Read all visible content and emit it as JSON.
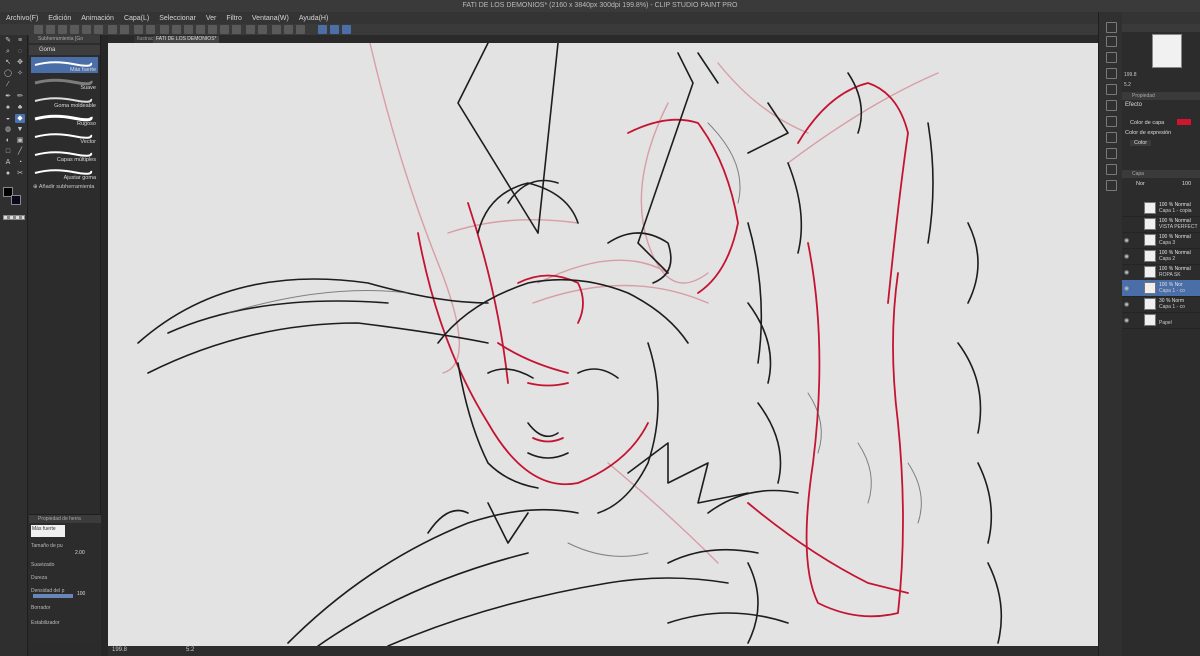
{
  "window": {
    "title": "FATI DE LOS DEMONIOS* (2160 x 3840px 300dpi 199.8%) - CLIP STUDIO PAINT PRO"
  },
  "menu": [
    "Archivo(F)",
    "Edición",
    "Animación",
    "Capa(L)",
    "Seleccionar",
    "Ver",
    "Filtro",
    "Ventana(W)",
    "Ayuda(H)"
  ],
  "tabs": [
    "Ilustración7",
    "FATI DE LOS DEMONIOS*"
  ],
  "subtool": {
    "header": "Subherramienta [Go",
    "group": "Goma",
    "brushes": [
      "Más fuerte",
      "Suave",
      "Goma moldeable",
      "Rugoso",
      "Vector",
      "Capas múltiples",
      "Ajustar goma"
    ],
    "add": "Añadir subherramienta"
  },
  "toolprop": {
    "header": "Propiedad de herra",
    "preset": "Más fuerte",
    "size_label": "Tamaño de pu",
    "size_value": "2.00",
    "smooth_label": "Suavizado",
    "hard_label": "Dureza",
    "density_label": "Densidad del p",
    "density_value": "100",
    "erase_label": "Borrador",
    "stab_label": "Estabilizador",
    "density_fill": 1.0
  },
  "status": {
    "zoom": "199.8",
    "angle": "5.2",
    "zoom_right": "199.8",
    "angle_right": "5.2"
  },
  "properties": {
    "header": "Propiedad",
    "effect": "Efecto",
    "layer_color": "Color de capa",
    "expression_color": "Color de expresión",
    "expression_value": "Color"
  },
  "layers_panel": {
    "header": "Capa",
    "blend": "Nor",
    "opacity": "100"
  },
  "layers": [
    {
      "pct": "100 % Normal",
      "name": "Capa 1 - copia",
      "selected": false,
      "visible": false
    },
    {
      "pct": "100 % Normal",
      "name": "VISTA PERFECT",
      "selected": false,
      "visible": false
    },
    {
      "pct": "100 % Normal",
      "name": "Capa 3",
      "selected": false,
      "visible": true
    },
    {
      "pct": "100 % Normal",
      "name": "Capa 2",
      "selected": false,
      "visible": true
    },
    {
      "pct": "100 % Normal",
      "name": "ROPA SK",
      "selected": false,
      "visible": true
    },
    {
      "pct": "100 % Nor",
      "name": "Capa 1 - co",
      "selected": true,
      "visible": true
    },
    {
      "pct": "30 % Norm",
      "name": "Capa 1 - co",
      "selected": false,
      "visible": true
    },
    {
      "pct": "",
      "name": "Papel",
      "selected": false,
      "visible": true
    }
  ],
  "colors": {
    "accent": "#4a6ea8",
    "layer_color": "#d0152e",
    "sketch_red": "#c41432",
    "ink": "#1d1d1d"
  }
}
